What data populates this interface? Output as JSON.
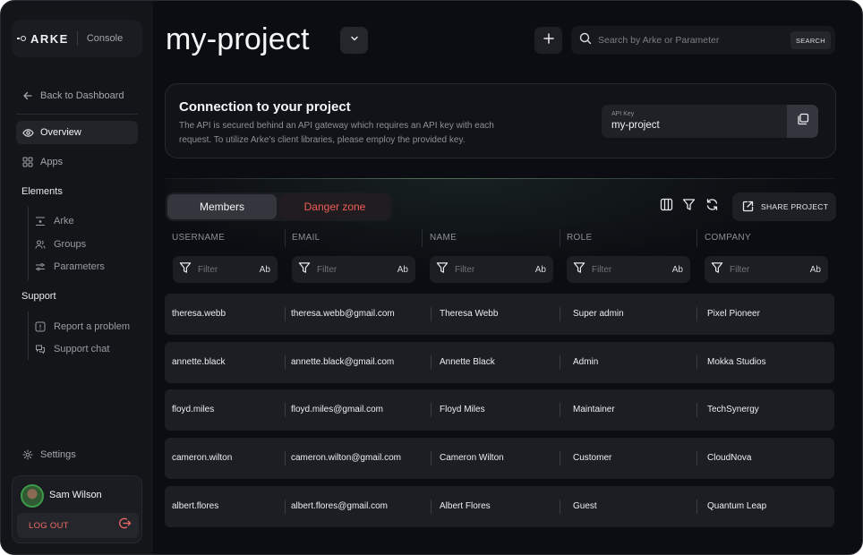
{
  "sidebar": {
    "brand": "ARKE",
    "console": "Console",
    "back": "Back to Dashboard",
    "overview": "Overview",
    "apps": "Apps",
    "elements_label": "Elements",
    "elements": [
      {
        "label": "Arke",
        "icon": "arke-icon"
      },
      {
        "label": "Groups",
        "icon": "groups-icon"
      },
      {
        "label": "Parameters",
        "icon": "parameters-icon"
      }
    ],
    "support_label": "Support",
    "support": [
      {
        "label": "Report a problem",
        "icon": "report-icon"
      },
      {
        "label": "Support chat",
        "icon": "chat-icon"
      }
    ],
    "settings": "Settings",
    "user": {
      "name": "Sam Wilson",
      "logout": "LOG OUT"
    }
  },
  "header": {
    "title": "my-project",
    "search_placeholder": "Search by Arke or Parameter",
    "search_button": "SEARCH"
  },
  "connection": {
    "title": "Connection to your project",
    "description": "The API is secured behind an API gateway which requires an API key with each request. To utilize Arke's client libraries, please employ the provided key.",
    "api_key_label": "API Key",
    "api_key_value": "my-project"
  },
  "tabs": {
    "members": "Members",
    "danger": "Danger zone"
  },
  "toolbar": {
    "share": "SHARE PROJECT"
  },
  "table": {
    "columns": [
      "USERNAME",
      "EMAIL",
      "NAME",
      "ROLE",
      "COMPANY"
    ],
    "filter_placeholder": "Filter",
    "filter_mode": "Ab",
    "rows": [
      [
        "theresa.webb",
        "theresa.webb@gmail.com",
        "Theresa Webb",
        "Super admin",
        "Pixel Pioneer"
      ],
      [
        "annette.black",
        "annette.black@gmail.com",
        "Annette Black",
        "Admin",
        "Mokka Studios"
      ],
      [
        "floyd.miles",
        "floyd.miles@gmail.com",
        "Floyd Miles",
        "Maintainer",
        "TechSynergy"
      ],
      [
        "cameron.wilton",
        "cameron.wilton@gmail.com",
        "Cameron Wilton",
        "Customer",
        "CloudNova"
      ],
      [
        "albert.flores",
        "albert.flores@gmail.com",
        "Albert Flores",
        "Guest",
        "Quantum Leap"
      ]
    ]
  },
  "colors": {
    "accent_red": "#ee5d58",
    "background": "#0c0d12",
    "panel": "#1d1e23"
  }
}
